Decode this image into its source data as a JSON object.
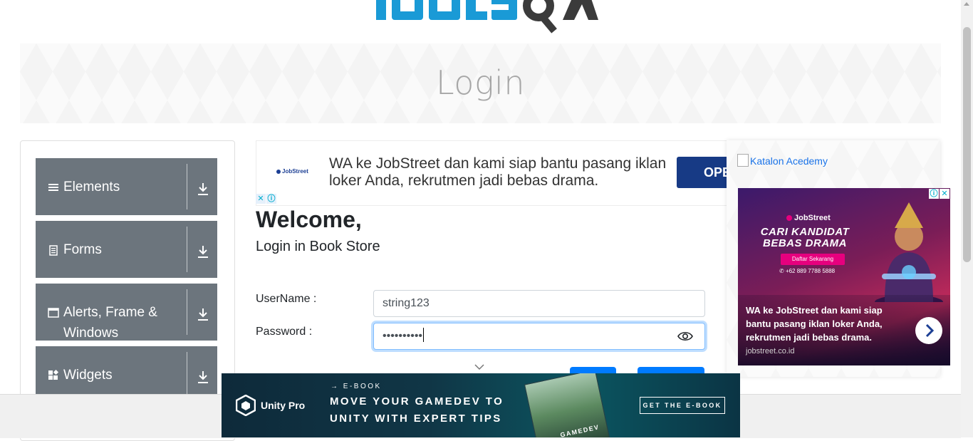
{
  "logo": {
    "text": "TOOLSQA"
  },
  "banner": {
    "title": "Login"
  },
  "sidebar": {
    "groups": [
      {
        "label": "Elements",
        "icon": "menu-icon"
      },
      {
        "label": "Forms",
        "icon": "form-icon"
      },
      {
        "label": "Alerts, Frame & Windows",
        "icon": "window-icon"
      },
      {
        "label": "Widgets",
        "icon": "widgets-icon"
      }
    ]
  },
  "ad_top": {
    "brand": "JobStreet",
    "text": "WA ke JobStreet dan kami siap bantu pasang iklan loker Anda, rekrutmen jadi bebas drama.",
    "button": "OPE",
    "close": "✕",
    "info": "ⓘ"
  },
  "form": {
    "welcome": "Welcome,",
    "subtitle": "Login in Book Store",
    "username_label": "UserName :",
    "username_value": "string123",
    "password_label": "Password :",
    "password_value": "••••••••••"
  },
  "right_ad": {
    "image_alt": "Katalon Acedemy",
    "jobstreet": {
      "brand": "JobStreet",
      "headline": "CARI KANDIDAT BEBAS DRAMA",
      "cta": "Daftar Sekarang",
      "phone": "+62 889 7788 5888",
      "desc": "WA ke JobStreet dan kami siap bantu pasang iklan loker Anda, rekrutmen jadi bebas drama.",
      "domain": "jobstreet.co.id",
      "info": "ⓘ",
      "close": "✕"
    }
  },
  "unity_ad": {
    "brand": "Unity Pro",
    "tag": "→ E-BOOK",
    "title": "MOVE YOUR GAMEDEV TO UNITY WITH EXPERT TIPS",
    "book_caption": "GAMEDEV",
    "button": "GET THE E-BOOK"
  },
  "colors": {
    "sidebar_group_bg": "#6c757d",
    "primary": "#007bff",
    "logo_blue": "#1a9ad6",
    "logo_dark": "#3b3b3b"
  }
}
